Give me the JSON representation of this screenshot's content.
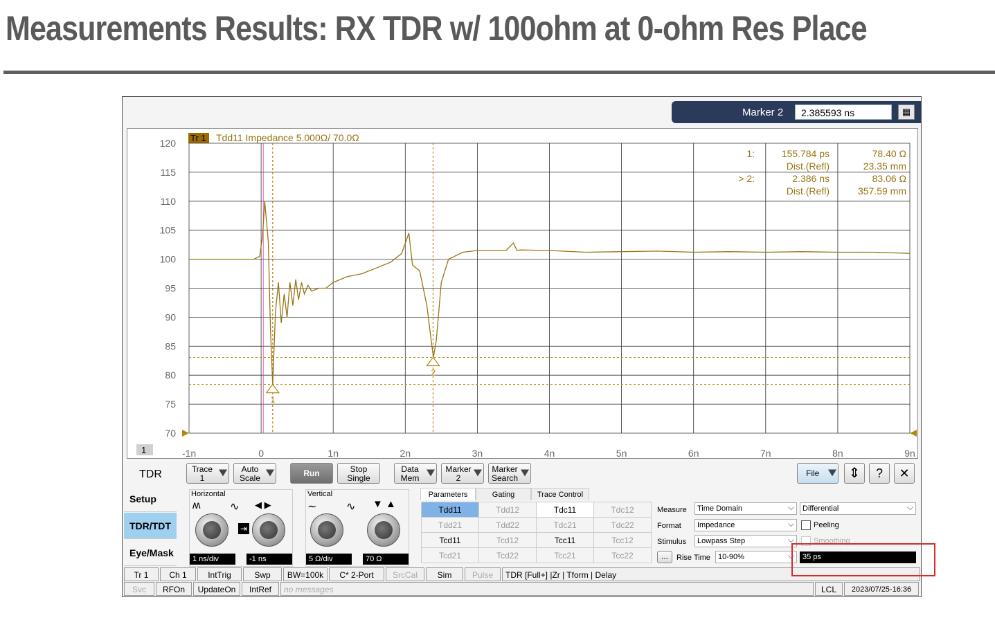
{
  "slide": {
    "title": "Measurements Results: RX TDR w/ 100ohm at 0-ohm Res Place"
  },
  "marker_bar": {
    "label": "Marker 2",
    "value": "2.385593 ns"
  },
  "trace": {
    "tag": "Tr 1",
    "description": "Tdd11 Impedance 5.000Ω/ 70.0Ω",
    "channel_tag": "1"
  },
  "marker_readout": {
    "rows": [
      {
        "id": "1:",
        "time": "155.784 ps",
        "value": "78.40 Ω"
      },
      {
        "id": "",
        "time": "Dist.(Refl)",
        "value": "23.35 mm"
      },
      {
        "id": "> 2:",
        "time": "2.386 ns",
        "value": "83.06 Ω"
      },
      {
        "id": "",
        "time": "Dist.(Refl)",
        "value": "357.59 mm"
      }
    ]
  },
  "chart_data": {
    "type": "line",
    "xlabel": "",
    "ylabel": "",
    "x_ticks": [
      "-1n",
      "0",
      "1n",
      "2n",
      "3n",
      "4n",
      "5n",
      "6n",
      "7n",
      "8n",
      "9n"
    ],
    "y_ticks": [
      "70",
      "75",
      "80",
      "85",
      "90",
      "95",
      "100",
      "105",
      "110",
      "115",
      "120"
    ],
    "xlim_ns": [
      -1,
      9
    ],
    "ylim_ohm": [
      70,
      120
    ],
    "grid": true,
    "series": [
      {
        "color": "#9a7412",
        "x_ns": [
          -1,
          -0.1,
          -0.02,
          0.02,
          0.05,
          0.1,
          0.13,
          0.16,
          0.2,
          0.24,
          0.28,
          0.32,
          0.36,
          0.4,
          0.44,
          0.48,
          0.52,
          0.56,
          0.6,
          0.65,
          0.7,
          0.8,
          0.9,
          1.0,
          1.2,
          1.4,
          1.6,
          1.8,
          1.95,
          2.05,
          2.1,
          2.15,
          2.2,
          2.3,
          2.35,
          2.39,
          2.43,
          2.5,
          2.6,
          2.8,
          3.0,
          3.4,
          3.5,
          3.55,
          3.6,
          4.0,
          4.5,
          5.0,
          5.5,
          6.0,
          6.5,
          7.0,
          7.5,
          8.0,
          8.5,
          9.0
        ],
        "y_ohm": [
          100,
          100,
          100.5,
          104,
          110,
          103,
          88,
          78.4,
          91,
          96,
          89,
          94,
          90,
          96,
          92,
          96.5,
          93,
          96,
          94,
          95.5,
          94.5,
          95,
          95,
          96,
          97,
          97.5,
          98.5,
          99.5,
          101,
          104.5,
          99,
          98.5,
          98,
          92,
          87,
          83.06,
          86,
          96,
          100,
          101.2,
          101.5,
          101.5,
          102.8,
          101.5,
          101.6,
          101.5,
          101.2,
          101.3,
          101.4,
          101.2,
          101.3,
          101.2,
          101.3,
          101.2,
          101.2,
          101
        ]
      }
    ],
    "markers": [
      {
        "label": "1",
        "x_ns": 0.16,
        "y_ohm": 78.4
      },
      {
        "label": "2",
        "x_ns": 2.386,
        "y_ohm": 83.06
      }
    ]
  },
  "toolbar": {
    "mode": "TDR",
    "trace_btn": "Trace\n1",
    "autoscale_btn": "Auto\nScale",
    "run_btn": "Run",
    "stop_btn": "Stop\nSingle",
    "datamem_btn": "Data\nMem",
    "marker_btn": "Marker\n2",
    "markersearch_btn": "Marker\nSearch",
    "file_btn": "File",
    "help_btn": "?",
    "close_btn": "✕"
  },
  "side_tabs": [
    "Setup",
    "TDR/TDT",
    "Eye/Mask"
  ],
  "horizontal": {
    "label": "Horizontal",
    "scale": "1 ns/div",
    "position": "-1 ns"
  },
  "vertical": {
    "label": "Vertical",
    "scale": "5 Ω/div",
    "position": "70 Ω"
  },
  "param_tabs": [
    "Parameters",
    "Gating",
    "Trace Control"
  ],
  "param_table": [
    [
      "Tdd11",
      "Tdd12",
      "Tdc11",
      "Tdc12"
    ],
    [
      "Tdd21",
      "Tdd22",
      "Tdc21",
      "Tdc22"
    ],
    [
      "Tcd11",
      "Tcd12",
      "Tcc11",
      "Tcc12"
    ],
    [
      "Tcd21",
      "Tcd22",
      "Tcc21",
      "Tcc22"
    ]
  ],
  "measure": {
    "measure_label": "Measure",
    "measure_value": "Time Domain",
    "mode_value": "Differential",
    "format_label": "Format",
    "format_value": "Impedance",
    "peeling_label": "Peeling",
    "stimulus_label": "Stimulus",
    "stimulus_value": "Lowpass Step",
    "smoothing_label": "Smoothing",
    "ellipsis": "...",
    "risetime_label": "Rise Time",
    "risetime_mode": "10-90%",
    "risetime_value": "35 ps"
  },
  "status1": [
    "Tr 1",
    "Ch 1",
    "IntTrig",
    "Swp",
    "BW=100k",
    "C* 2-Port",
    "SrcCal",
    "Sim",
    "Pulse",
    "TDR [Full+] |Zr | Tform | Delay"
  ],
  "status2": [
    "Svc",
    "RFOn",
    "UpdateOn",
    "IntRef",
    "no messages",
    "LCL",
    "2023/07/25-16:36"
  ]
}
